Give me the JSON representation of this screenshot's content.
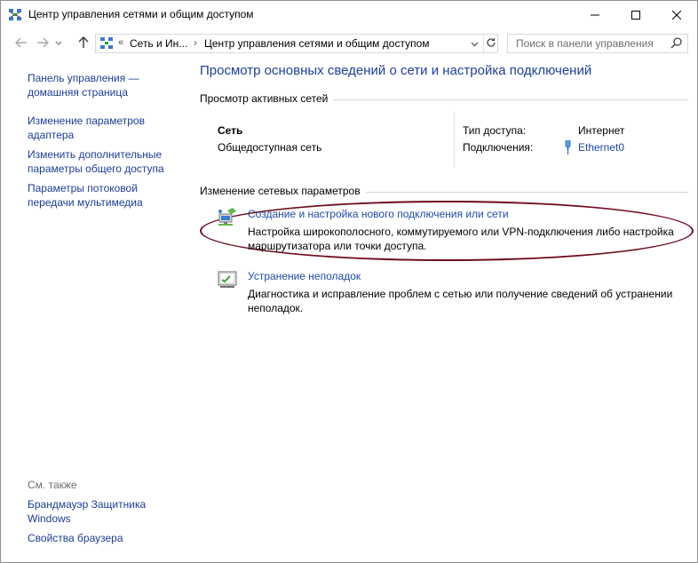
{
  "window": {
    "title": "Центр управления сетями и общим доступом",
    "caption": {
      "minimize": "—",
      "maximize": "☐",
      "close": "✕"
    }
  },
  "address_bar": {
    "chevron": "«",
    "segments": [
      "Сеть и Ин...",
      "Центр управления сетями и общим доступом"
    ],
    "separator": "›",
    "search_placeholder": "Поиск в панели управления"
  },
  "left_pane": {
    "links": [
      "Панель управления — домашняя страница",
      "Изменение параметров адаптера",
      "Изменить дополнительные параметры общего доступа",
      "Параметры потоковой передачи мультимедиа"
    ],
    "see_also_label": "См. также",
    "see_also_links": [
      "Брандмауэр Защитника Windows",
      "Свойства браузера"
    ]
  },
  "main": {
    "title": "Просмотр основных сведений о сети и настройка подключений",
    "active_networks_label": "Просмотр активных сетей",
    "network": {
      "name": "Сеть",
      "type": "Общедоступная сеть",
      "access_type_label": "Тип доступа:",
      "access_type_value": "Интернет",
      "connections_label": "Подключения:",
      "connections_value": "Ethernet0"
    },
    "change_settings_label": "Изменение сетевых параметров",
    "tasks": [
      {
        "title": "Создание и настройка нового подключения или сети",
        "description": "Настройка широкополосного, коммутируемого или VPN-подключения либо настройка маршрутизатора или точки доступа."
      },
      {
        "title": "Устранение неполадок",
        "description": "Диагностика и исправление проблем с сетью или получение сведений об устранении неполадок."
      }
    ]
  },
  "colors": {
    "link": "#1f4aa5",
    "title_blue": "#1e3f97",
    "highlight_ellipse": "#6d0d1f"
  },
  "icons": [
    "network-center-icon",
    "back-arrow-icon",
    "forward-arrow-icon",
    "up-arrow-icon",
    "refresh-icon",
    "search-icon",
    "ethernet-icon",
    "new-connection-icon",
    "troubleshoot-icon"
  ]
}
